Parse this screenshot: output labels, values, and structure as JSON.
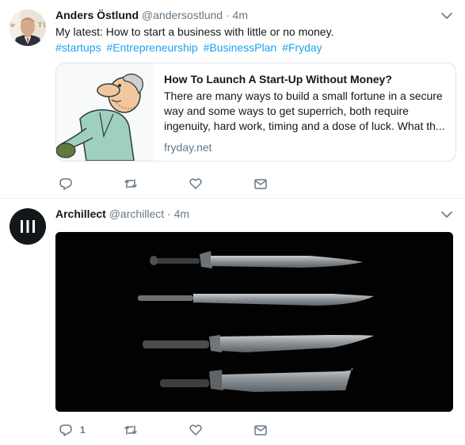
{
  "tweets": [
    {
      "author_name": "Anders Östlund",
      "handle": "@andersostlund",
      "separator": "·",
      "time": "4m",
      "text": "My latest: How to start a business with little or no money.",
      "hashtags": [
        "#startups",
        "#Entrepreneurship",
        "#BusinessPlan",
        "#Fryday"
      ],
      "avatar_partial_text": "ie T D",
      "card": {
        "title": "How To Launch A Start-Up Without Money?",
        "description": "There are many ways to build a small fortune in a secure way and some ways to get superrich, both require ingenuity, hard work, timing and a dose of luck. What th...",
        "domain": "fryday.net"
      },
      "actions": {
        "reply_count": "",
        "retweet_count": "",
        "like_count": ""
      }
    },
    {
      "author_name": "Archillect",
      "handle": "@archillect",
      "separator": "·",
      "time": "4m",
      "actions": {
        "reply_count": "1",
        "retweet_count": "",
        "like_count": ""
      }
    }
  ],
  "colors": {
    "link": "#1da1f2",
    "secondary_text": "#657786",
    "border": "#e1e8ed",
    "icon": "#657786"
  },
  "icons": [
    "caret-down-icon",
    "reply-icon",
    "retweet-icon",
    "like-icon",
    "direct-message-icon",
    "archillect-logo-icon"
  ]
}
